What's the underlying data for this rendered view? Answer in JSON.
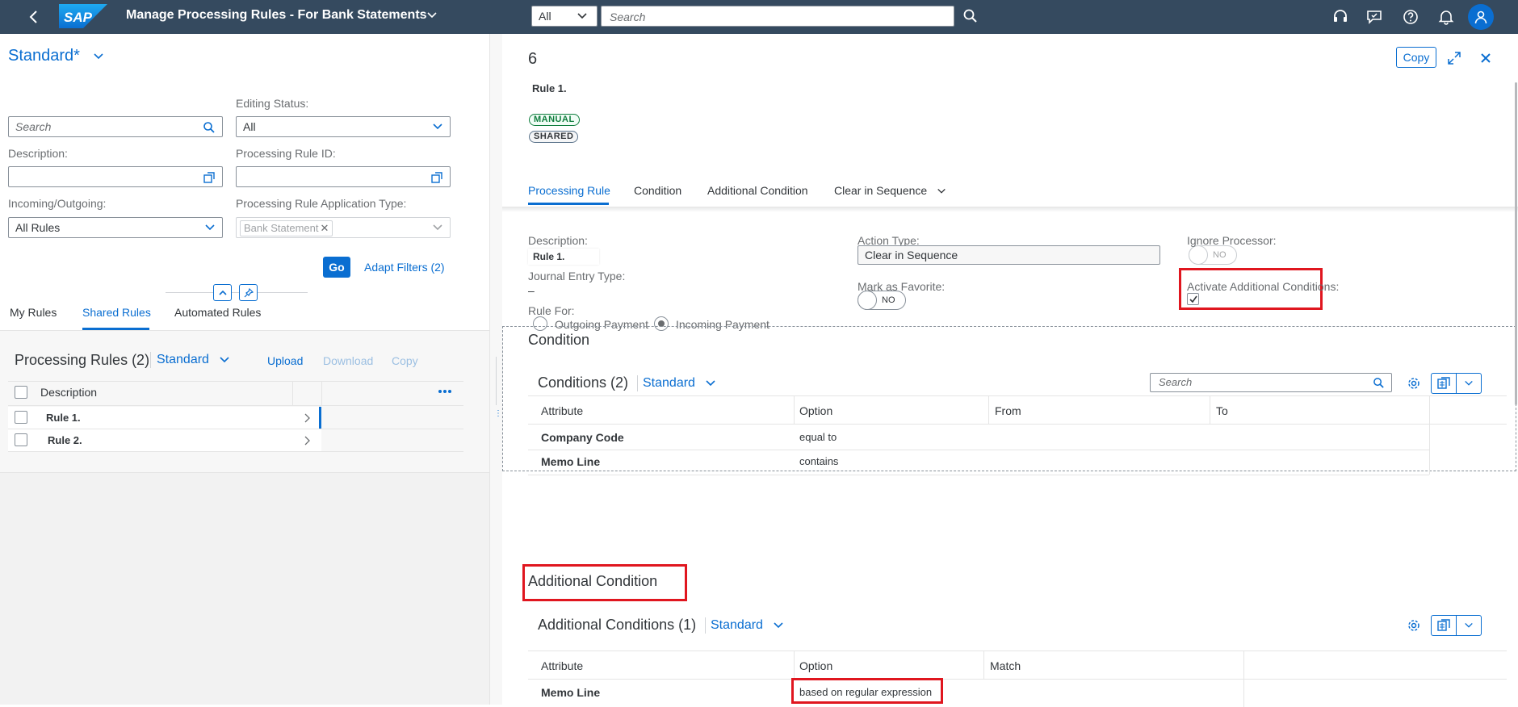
{
  "shell": {
    "logo": "SAP",
    "app_title": "Manage Processing Rules - For Bank Statements",
    "search_scope": "All",
    "search_placeholder": "Search"
  },
  "left": {
    "variant": "Standard",
    "variant_star": "*",
    "filters": {
      "search_placeholder": "Search",
      "editing_status_label": "Editing Status:",
      "editing_status_value": "All",
      "description_label": "Description:",
      "processing_rule_id_label": "Processing Rule ID:",
      "incoming_outgoing_label": "Incoming/Outgoing:",
      "incoming_outgoing_value": "All Rules",
      "application_type_label": "Processing Rule Application Type:",
      "application_type_token": "Bank Statement"
    },
    "go_label": "Go",
    "adapt_filters_label": "Adapt Filters (2)",
    "tabs": [
      "My Rules",
      "Shared Rules",
      "Automated Rules"
    ],
    "selected_tab": "Shared Rules",
    "table": {
      "title": "Processing Rules (2)",
      "variant": "Standard",
      "upload": "Upload",
      "download": "Download",
      "copy": "Copy",
      "column_description": "Description",
      "rows": [
        "Rule 1.",
        "Rule 2."
      ]
    }
  },
  "right": {
    "object_title": "6",
    "object_subtitle": "Rule 1.",
    "badges": [
      "MANUAL",
      "SHARED"
    ],
    "copy_button": "Copy",
    "tabs": [
      "Processing Rule",
      "Condition",
      "Additional Condition",
      "Clear in Sequence"
    ],
    "selected_tab": "Processing Rule",
    "fields": {
      "description_label": "Description:",
      "description_value": "Rule 1.",
      "journal_entry_type_label": "Journal Entry Type:",
      "journal_entry_type_value": "–",
      "rule_for_label": "Rule For:",
      "rule_for_options": [
        "Outgoing Payment",
        "Incoming Payment"
      ],
      "rule_for_selected": "Incoming Payment",
      "action_type_label": "Action Type:",
      "action_type_value": "Clear in Sequence",
      "mark_favorite_label": "Mark as Favorite:",
      "mark_favorite_value": "NO",
      "ignore_processor_label": "Ignore Processor:",
      "ignore_processor_value": "NO",
      "activate_additional_label": "Activate Additional Conditions:",
      "activate_additional_checked": true
    },
    "condition": {
      "section_title": "Condition",
      "table_title": "Conditions (2)",
      "variant": "Standard",
      "search_placeholder": "Search",
      "columns": [
        "Attribute",
        "Option",
        "From",
        "To"
      ],
      "rows": [
        {
          "attribute": "Company Code",
          "option": "equal to"
        },
        {
          "attribute": "Memo Line",
          "option": "contains"
        }
      ]
    },
    "additional_condition": {
      "section_title": "Additional Condition",
      "table_title": "Additional Conditions (1)",
      "variant": "Standard",
      "columns": [
        "Attribute",
        "Option",
        "Match"
      ],
      "rows": [
        {
          "attribute": "Memo Line",
          "option": "based on regular expression"
        }
      ]
    }
  },
  "colors": {
    "shell_bg": "#354a5f",
    "accent": "#0a6ed1",
    "highlight": "#e0161f"
  }
}
